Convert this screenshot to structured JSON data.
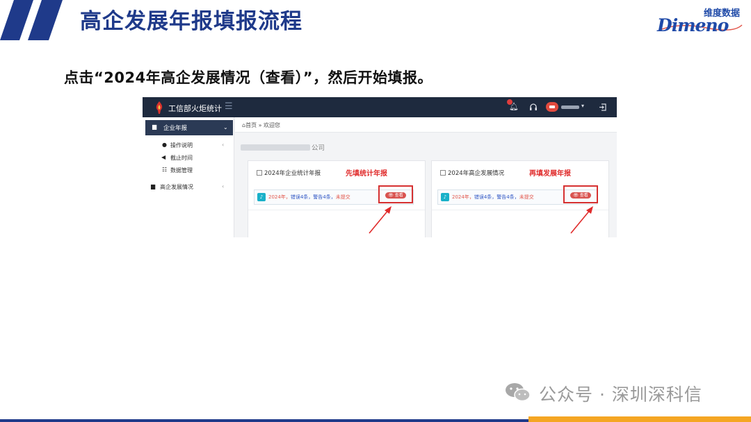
{
  "slide": {
    "title": "高企发展年报填报流程",
    "instruction": "点击“2024年高企发展情况（查看）”，然后开始填报。",
    "logo": {
      "cn": "维度数据",
      "en": "Dimeno"
    }
  },
  "app": {
    "name": "工信部火炬统计",
    "menu_icon": "hamburger-icon",
    "nav_icons": [
      "bell-icon",
      "headset-icon",
      "user-avatar",
      "logout-icon"
    ],
    "sidebar": {
      "active": "企业年报",
      "items": [
        "操作说明",
        "截止时间",
        "数据管理"
      ],
      "group2": "高企发展情况"
    },
    "breadcrumb": "⌂首页 » 欢迎您",
    "company": "公司",
    "cards": [
      {
        "title": "2024年企业统计年报",
        "note": "先填统计年报",
        "row": {
          "year": "2024年，",
          "error": "错误4条，",
          "warn": "警告4条，",
          "status": "未提交"
        },
        "button": "查看"
      },
      {
        "title": "2024年高企发展情况",
        "note": "再填发展年报",
        "row": {
          "year": "2024年，",
          "error": "错误4条，",
          "warn": "警告4条，",
          "status": "未提交"
        },
        "button": "查看"
      }
    ]
  },
  "watermark": "公众号 · 深圳深科信",
  "colors": {
    "title": "#1f3a8a",
    "nav": "#1e2a3e",
    "annotation": "#e02b2b",
    "footer_orange": "#f5a623"
  }
}
